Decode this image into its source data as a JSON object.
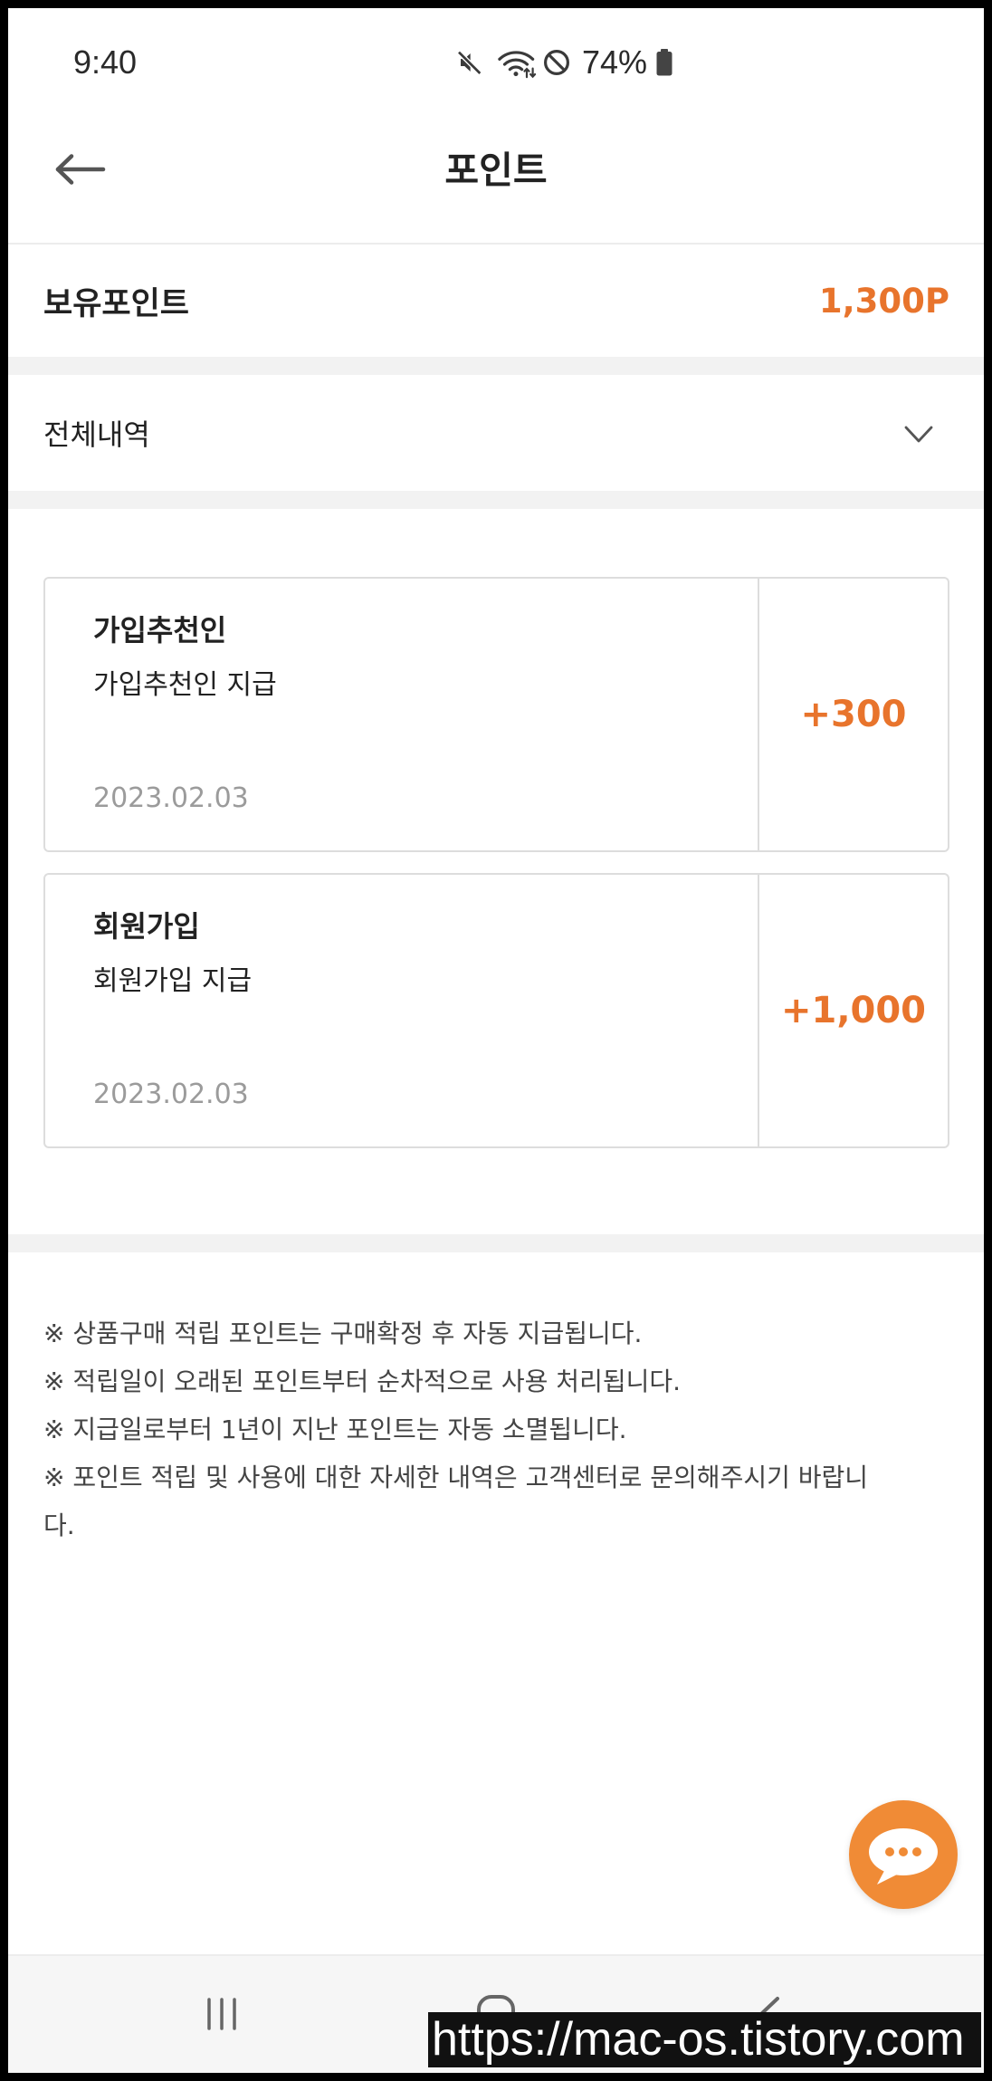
{
  "colors": {
    "accent": "#e8742c",
    "fab": "#f08b36",
    "band": "#f2f2f2",
    "border": "#dddddd",
    "muted_text": "#9b9b9b",
    "text": "#222222",
    "icon": "#555555",
    "navbar": "#f6f6f6"
  },
  "status_bar": {
    "time": "9:40",
    "battery": "74%",
    "icons": [
      "mute-icon",
      "wifi-icon",
      "do-not-disturb-icon",
      "battery-icon"
    ]
  },
  "header": {
    "title": "포인트",
    "back_icon": "back-arrow-icon"
  },
  "balance": {
    "label": "보유포인트",
    "value": "1,300P"
  },
  "filter": {
    "selected": "전체내역",
    "icon": "chevron-down-icon"
  },
  "history": {
    "items": [
      {
        "title": "가입추천인",
        "description": "가입추천인 지급",
        "date": "2023.02.03",
        "amount": "+300"
      },
      {
        "title": "회원가입",
        "description": "회원가입 지급",
        "date": "2023.02.03",
        "amount": "+1,000"
      }
    ]
  },
  "notice": {
    "lines": [
      "※ 상품구매 적립 포인트는 구매확정 후 자동 지급됩니다.",
      "※ 적립일이 오래된 포인트부터 순차적으로 사용 처리됩니다.",
      "※ 지급일로부터 1년이 지난 포인트는 자동 소멸됩니다.",
      "※ 포인트 적립 및 사용에 대한 자세한 내역은 고객센터로 문의해주시기 바랍니다."
    ]
  },
  "chat_button": {
    "icon": "chat-bubble-icon"
  },
  "nav_bar": {
    "icons": [
      "recent-apps-icon",
      "home-icon",
      "back-icon"
    ]
  },
  "watermark": {
    "text": "https://mac-os.tistory.com"
  }
}
